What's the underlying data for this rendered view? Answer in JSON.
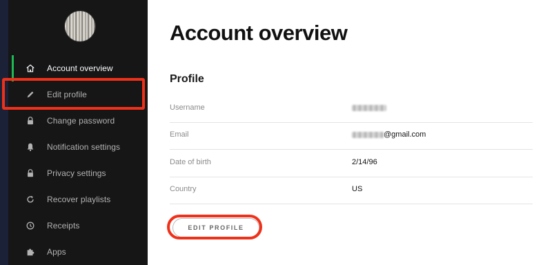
{
  "sidebar": {
    "items": [
      {
        "label": "Account overview",
        "icon": "home-icon",
        "active": true
      },
      {
        "label": "Edit profile",
        "icon": "pen-icon",
        "active": false
      },
      {
        "label": "Change password",
        "icon": "lock-icon",
        "active": false
      },
      {
        "label": "Notification settings",
        "icon": "bell-icon",
        "active": false
      },
      {
        "label": "Privacy settings",
        "icon": "lock-icon",
        "active": false
      },
      {
        "label": "Recover playlists",
        "icon": "refresh-icon",
        "active": false
      },
      {
        "label": "Receipts",
        "icon": "clock-icon",
        "active": false
      },
      {
        "label": "Apps",
        "icon": "puzzle-icon",
        "active": false
      }
    ]
  },
  "main": {
    "title": "Account overview",
    "profile": {
      "heading": "Profile",
      "rows": [
        {
          "label": "Username",
          "value": ""
        },
        {
          "label": "Email",
          "value": "@gmail.com"
        },
        {
          "label": "Date of birth",
          "value": "2/14/96"
        },
        {
          "label": "Country",
          "value": "US"
        }
      ],
      "edit_button": "EDIT PROFILE"
    }
  },
  "colors": {
    "accent": "#1db954",
    "highlight": "#f0311a",
    "sidebar_bg": "#161616"
  }
}
